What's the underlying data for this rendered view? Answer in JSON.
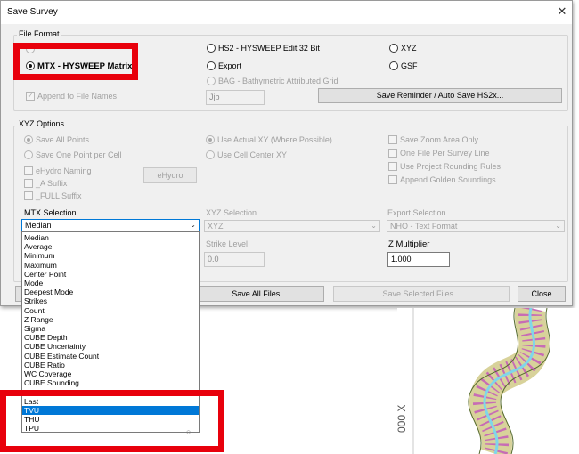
{
  "dialog": {
    "title": "Save Survey",
    "close_glyph": "✕"
  },
  "file_format": {
    "label": "File Format",
    "options": {
      "mtx": "MTX - HYSWEEP Matrix",
      "hs2": "HS2 - HYSWEEP Edit 32 Bit",
      "xyz": "XYZ",
      "export": "Export",
      "gsf": "GSF",
      "bag": "BAG - Bathymetric Attributed Grid"
    },
    "append_label": "Append to File Names",
    "append_value": "Jjb",
    "save_reminder_button": "Save Reminder / Auto Save HS2x..."
  },
  "xyz_options": {
    "label": "XYZ Options",
    "save_all_points": "Save All Points",
    "save_one_point": "Save One Point per Cell",
    "use_actual_xy": "Use Actual XY (Where Possible)",
    "use_cell_center": "Use Cell Center XY",
    "save_zoom_area": "Save Zoom Area Only",
    "one_file_per_line": "One File Per Survey Line",
    "use_project_rounding": "Use Project Rounding Rules",
    "append_golden": "Append Golden Soundings",
    "ehydro_naming": "eHydro Naming",
    "a_suffix": "_A Suffix",
    "full_suffix": "_FULL Suffix",
    "ehydro_button": "eHydro"
  },
  "selections": {
    "mtx_label": "MTX Selection",
    "mtx_value": "Median",
    "xyz_label": "XYZ Selection",
    "xyz_value": "XYZ",
    "export_label": "Export Selection",
    "export_value": "NHO - Text Format",
    "strike_label": "Strike Level",
    "strike_value": "0.0",
    "zmult_label": "Z Multiplier",
    "zmult_value": "1.000"
  },
  "buttons": {
    "save_all": "Save All Files...",
    "save_selected": "Save Selected Files...",
    "close": "Close"
  },
  "mtx_dropdown": {
    "items": [
      "Median",
      "Average",
      "Minimum",
      "Maximum",
      "Center Point",
      "Mode",
      "Deepest Mode",
      "Strikes",
      "Count",
      "Z Range",
      "Sigma",
      "CUBE Depth",
      "CUBE Uncertainty",
      "CUBE Estimate Count",
      "CUBE Ratio",
      "WC Coverage",
      "CUBE Sounding",
      "",
      "Last",
      "TVU",
      "THU",
      "TPU"
    ],
    "selected": "TVU"
  },
  "background": {
    "axis_label": "000 X"
  },
  "colors": {
    "highlight_red": "#e8000c",
    "selection_blue": "#0078d7",
    "track_yellow": "#d8d29a",
    "track_cyan": "#7fd6ea",
    "track_magenta": "#c040c0"
  }
}
